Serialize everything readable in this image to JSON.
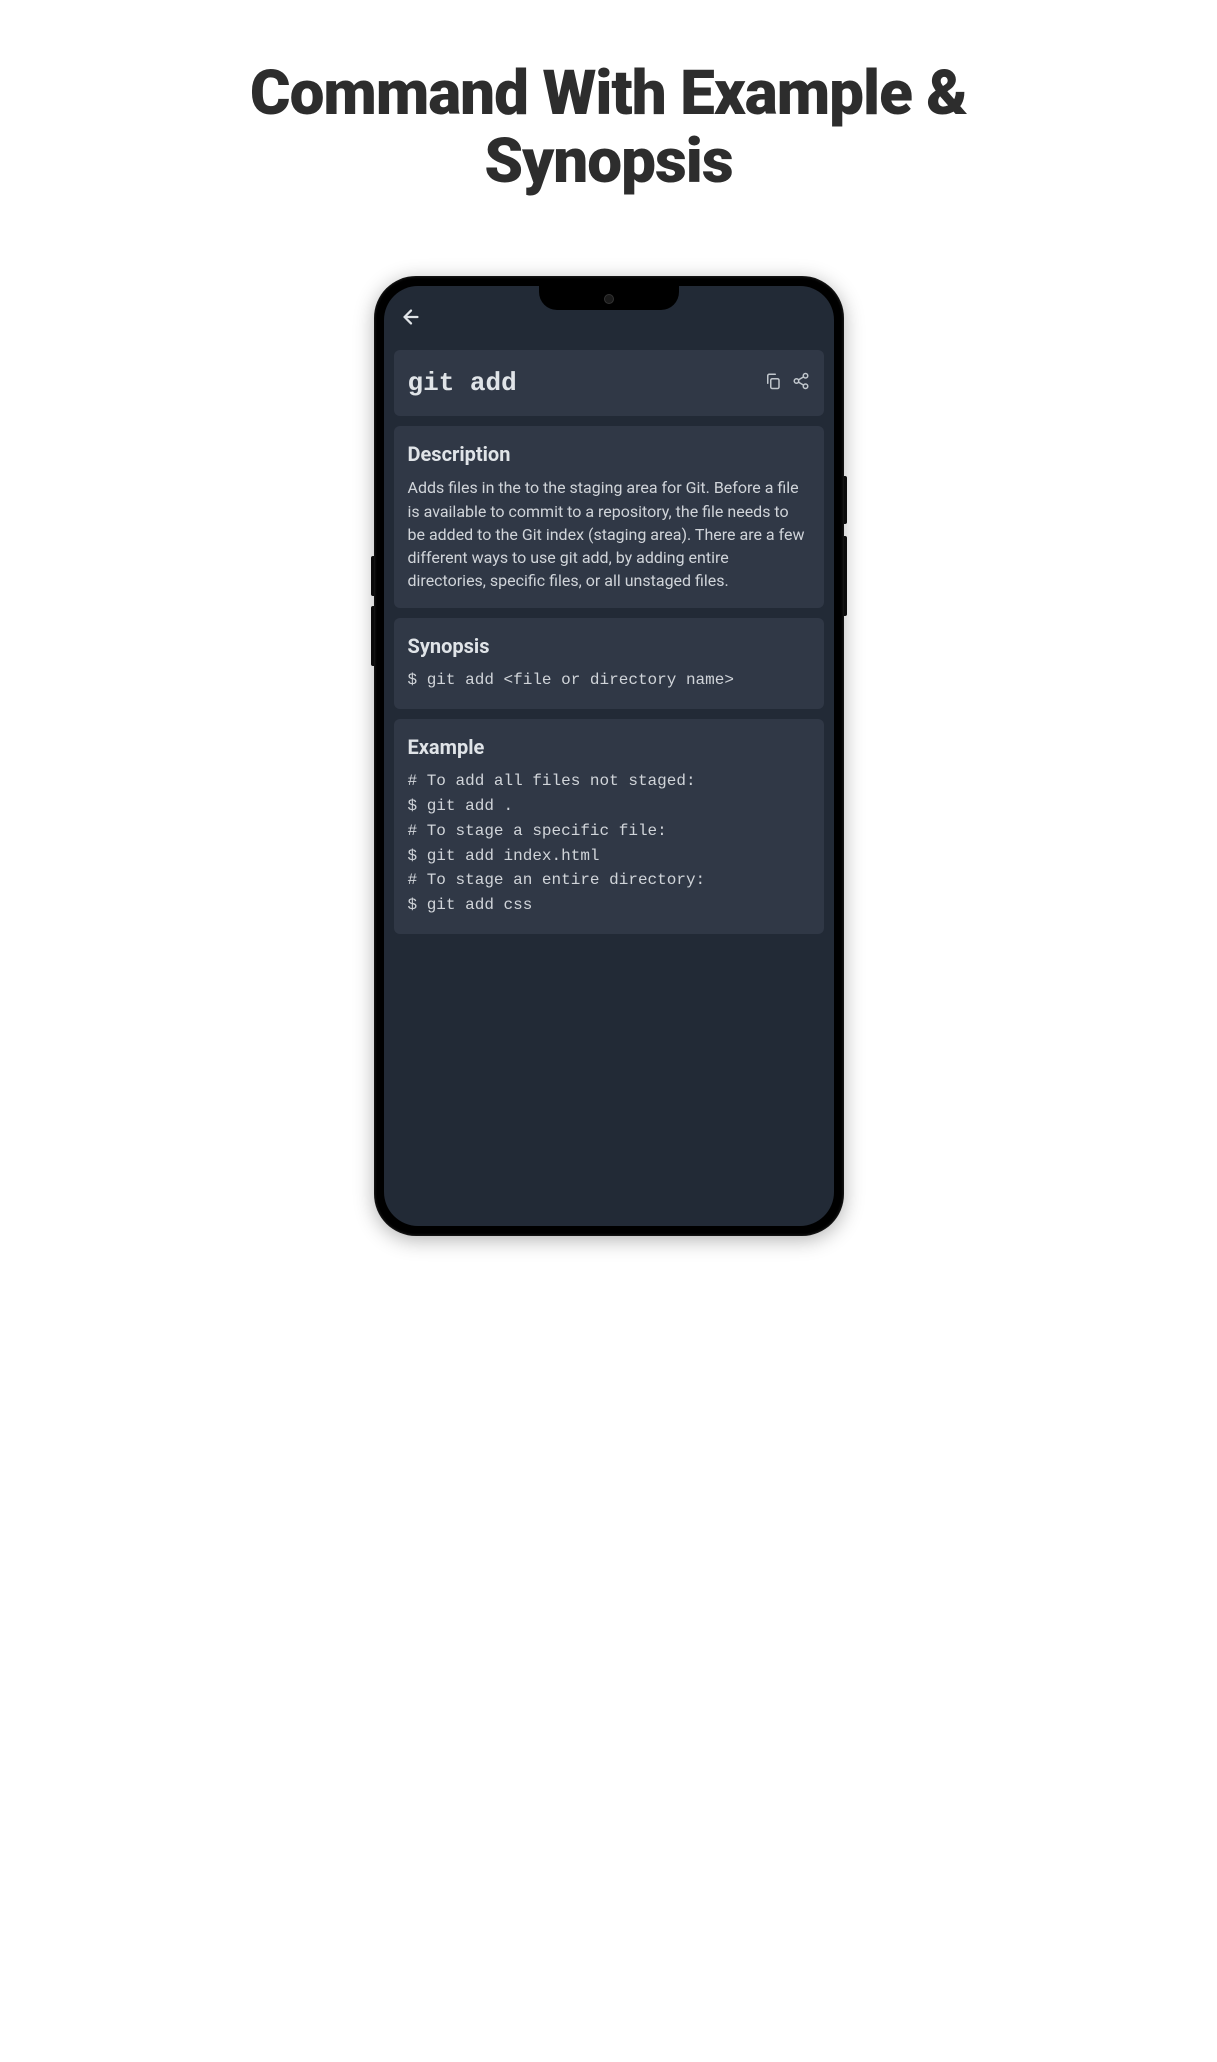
{
  "page": {
    "title": "Command With Example & Synopsis"
  },
  "app": {
    "command": "git add",
    "sections": {
      "description": {
        "heading": "Description",
        "body": "Adds files in the to the staging area for Git. Before a file is available to commit to a repository, the file needs to be added to the Git index (staging area). There are a few different ways to use git add, by adding entire directories, specific files, or all unstaged files."
      },
      "synopsis": {
        "heading": "Synopsis",
        "code": "$ git add <file or directory name>"
      },
      "example": {
        "heading": "Example",
        "code": "# To add all files not staged:\n$ git add .\n# To stage a specific file:\n$ git add index.html\n# To stage an entire directory:\n$ git add css"
      }
    }
  }
}
